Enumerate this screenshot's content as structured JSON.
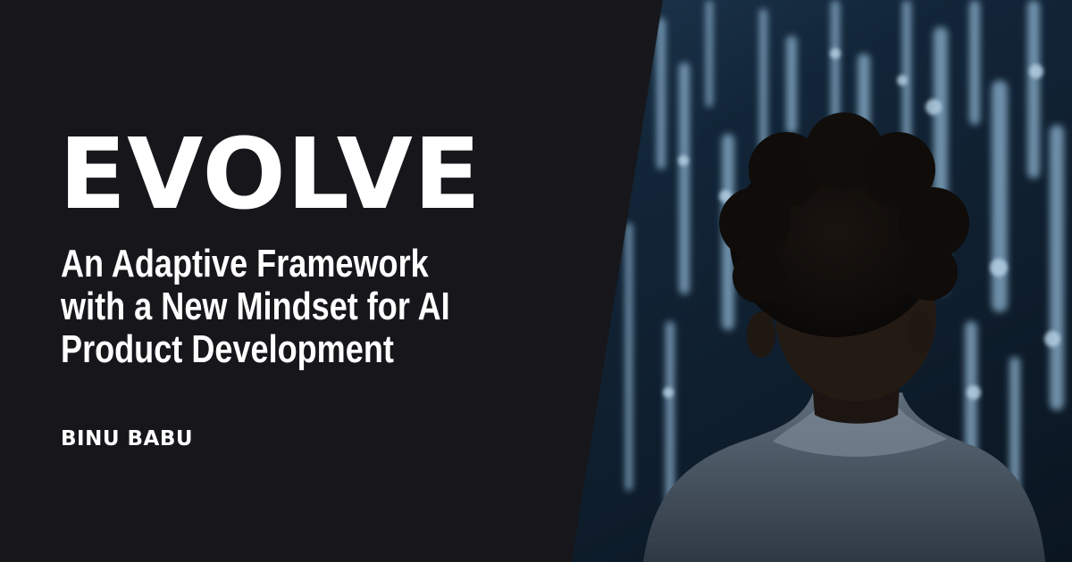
{
  "card": {
    "title": "EVOLVE",
    "subtitle_lines": [
      "An Adaptive Framework",
      "with a New Mindset for AI",
      "Product Development"
    ],
    "author": "BINU BABU"
  },
  "colors": {
    "panel_background": "#17171b",
    "text": "#ffffff",
    "image_background": "#0f2030",
    "code_glow": "#7ea9c8"
  },
  "image": {
    "subject": "person-silhouette-facing-digital-code-wall"
  }
}
